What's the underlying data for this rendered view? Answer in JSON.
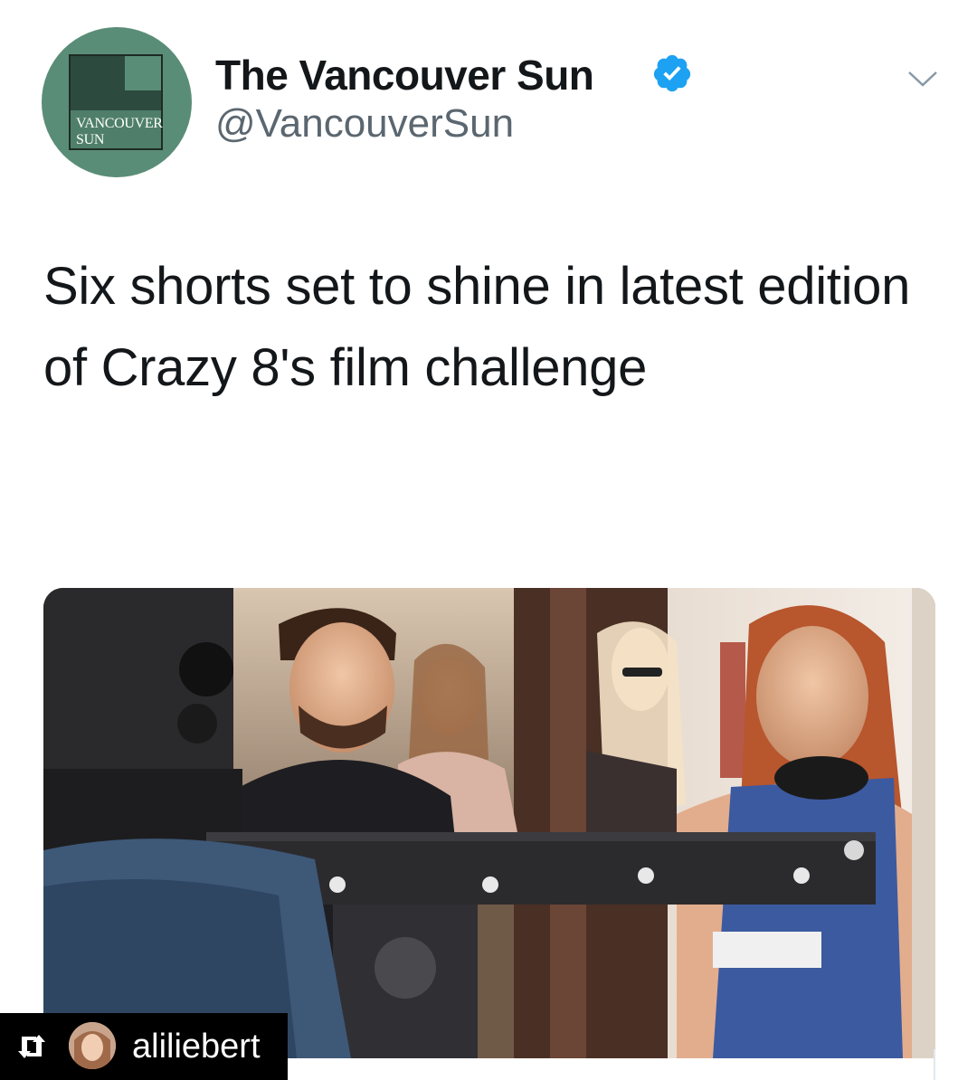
{
  "account": {
    "avatar_text_line1": "VANCOUVER",
    "avatar_text_line2": "SUN",
    "display_name": "The Vancouver Sun",
    "handle": "@VancouverSun",
    "verified": true
  },
  "icons": {
    "verified": "verified-badge-icon",
    "menu": "chevron-down-icon",
    "repost": "repost-icon"
  },
  "tweet": {
    "text": "Six shorts set to shine in latest edition of Crazy 8's film challenge"
  },
  "media": {
    "description_icon": "film-set-photo"
  },
  "repost": {
    "username": "aliliebert"
  },
  "colors": {
    "avatar_bg": "#5a8d77",
    "verified_blue": "#1da1f2",
    "handle_gray": "#5b6770"
  }
}
